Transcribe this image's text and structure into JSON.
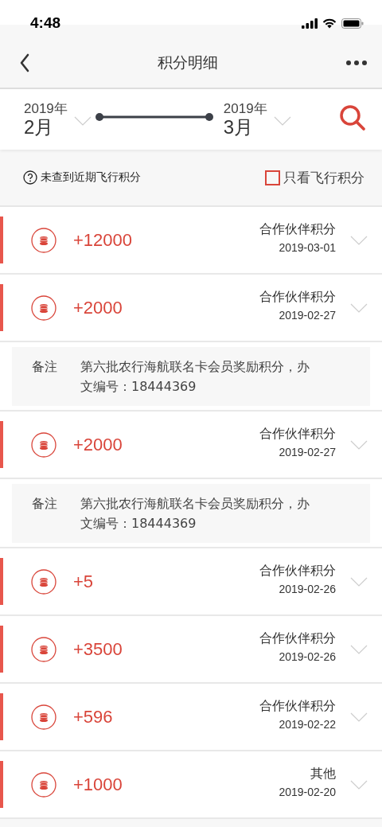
{
  "status_bar": {
    "time": "4:48"
  },
  "nav": {
    "title": "积分明细"
  },
  "date_range": {
    "start": {
      "year": "2019年",
      "month": "2月"
    },
    "end": {
      "year": "2019年",
      "month": "3月"
    }
  },
  "filter": {
    "hint": "未查到近期飞行积分",
    "checkbox": {
      "label": "只看飞行积分",
      "checked": false
    }
  },
  "records": [
    {
      "amount": "+12000",
      "category": "合作伙伴积分",
      "date": "2019-03-01"
    },
    {
      "amount": "+2000",
      "category": "合作伙伴积分",
      "date": "2019-02-27",
      "note_label": "备注",
      "note": "第六批农行海航联名卡会员奖励积分，办文编号：18444369"
    },
    {
      "amount": "+2000",
      "category": "合作伙伴积分",
      "date": "2019-02-27",
      "note_label": "备注",
      "note": "第六批农行海航联名卡会员奖励积分，办文编号：18444369"
    },
    {
      "amount": "+5",
      "category": "合作伙伴积分",
      "date": "2019-02-26"
    },
    {
      "amount": "+3500",
      "category": "合作伙伴积分",
      "date": "2019-02-26"
    },
    {
      "amount": "+596",
      "category": "合作伙伴积分",
      "date": "2019-02-22"
    },
    {
      "amount": "+1000",
      "category": "其他",
      "date": "2019-02-20"
    }
  ]
}
